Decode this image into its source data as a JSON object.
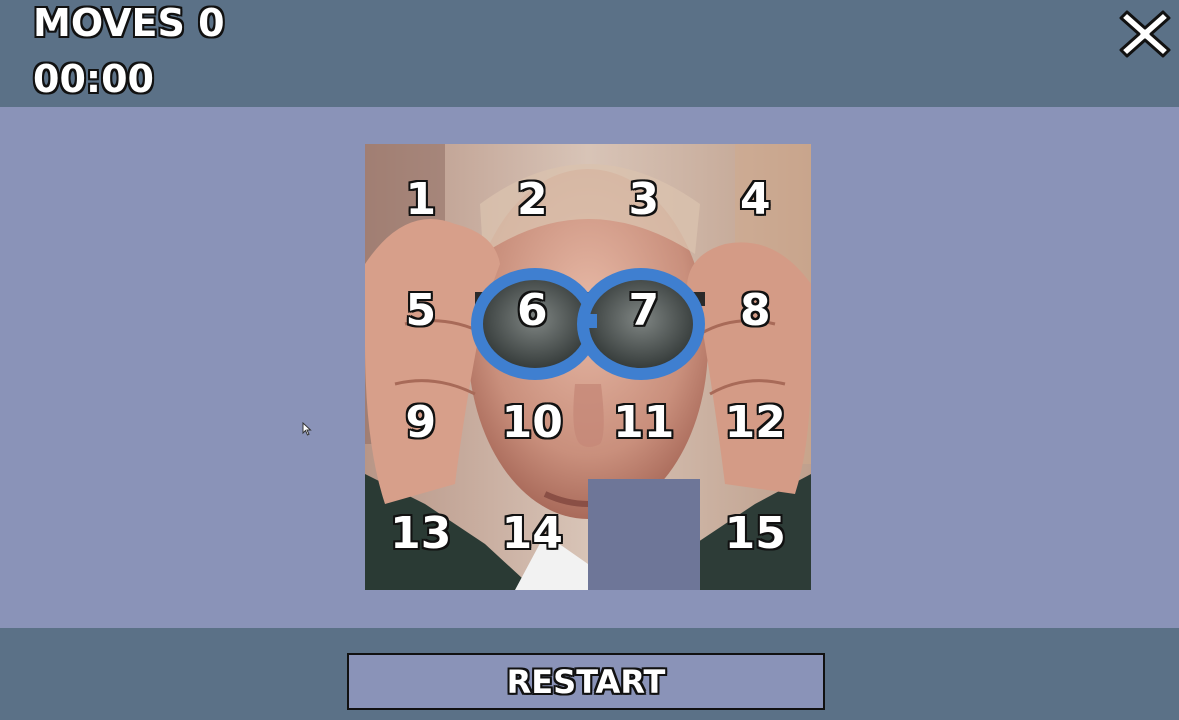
{
  "hud": {
    "moves_label": "MOVES 0",
    "timer": "00:00"
  },
  "controls": {
    "close_icon": "close-x-icon",
    "restart_label": "RESTART"
  },
  "puzzle": {
    "grid_size": 4,
    "tiles": [
      "1",
      "2",
      "3",
      "4",
      "5",
      "6",
      "7",
      "8",
      "9",
      "10",
      "11",
      "12",
      "13",
      "14",
      "",
      "15"
    ],
    "empty_index": 14,
    "image": "portrait photo of a man wearing blue-rimmed goggles"
  },
  "colors": {
    "bar": "#5b7187",
    "background": "#8a93b8",
    "empty_tile": "#6e7698"
  }
}
